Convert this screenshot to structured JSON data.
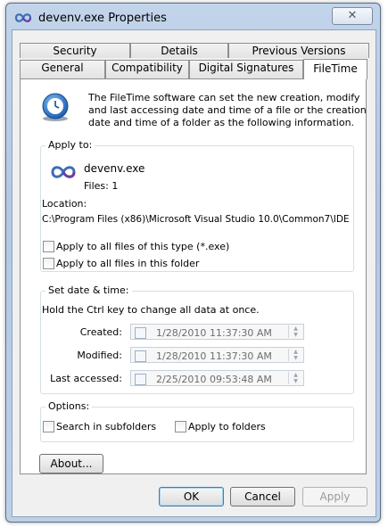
{
  "window": {
    "title": "devenv.exe Properties",
    "close_symbol": "✕"
  },
  "tabs": {
    "row1": [
      "Security",
      "Details",
      "Previous Versions"
    ],
    "row2": [
      "General",
      "Compatibility",
      "Digital Signatures",
      "FileTime"
    ]
  },
  "intro": {
    "line1": "The FileTime software can set the new creation, modify",
    "line2": "and last accessing date and time of a file or the creation",
    "line3": "date and time of a folder as the following information."
  },
  "apply_to": {
    "label": "Apply to:",
    "file_name": "devenv.exe",
    "files_count": "Files: 1",
    "location_label": "Location:",
    "location_path": "C:\\Program Files (x86)\\Microsoft Visual Studio 10.0\\Common7\\IDE",
    "check_type": "Apply to all files of this type (*.exe)",
    "check_folder": "Apply to all files in this folder"
  },
  "set_date": {
    "label": "Set date & time:",
    "hint": "Hold the Ctrl key to change all data at once.",
    "rows": [
      {
        "label": "Created:",
        "date": "1/28/2010",
        "time": "11:37:30 AM"
      },
      {
        "label": "Modified:",
        "date": "1/28/2010",
        "time": "11:37:30 AM"
      },
      {
        "label": "Last accessed:",
        "date": "2/25/2010",
        "time": "09:53:48 AM"
      }
    ]
  },
  "options": {
    "label": "Options:",
    "search_sub": "Search in subfolders",
    "apply_folders": "Apply to folders"
  },
  "buttons": {
    "about": "About...",
    "ok": "OK",
    "cancel": "Cancel",
    "apply": "Apply"
  },
  "icons": {
    "app": "visual-studio-infinity-icon",
    "clock": "clock-icon"
  },
  "colors": {
    "accent": "#3b6fb6",
    "vs_purple": "#6a3fa0"
  }
}
